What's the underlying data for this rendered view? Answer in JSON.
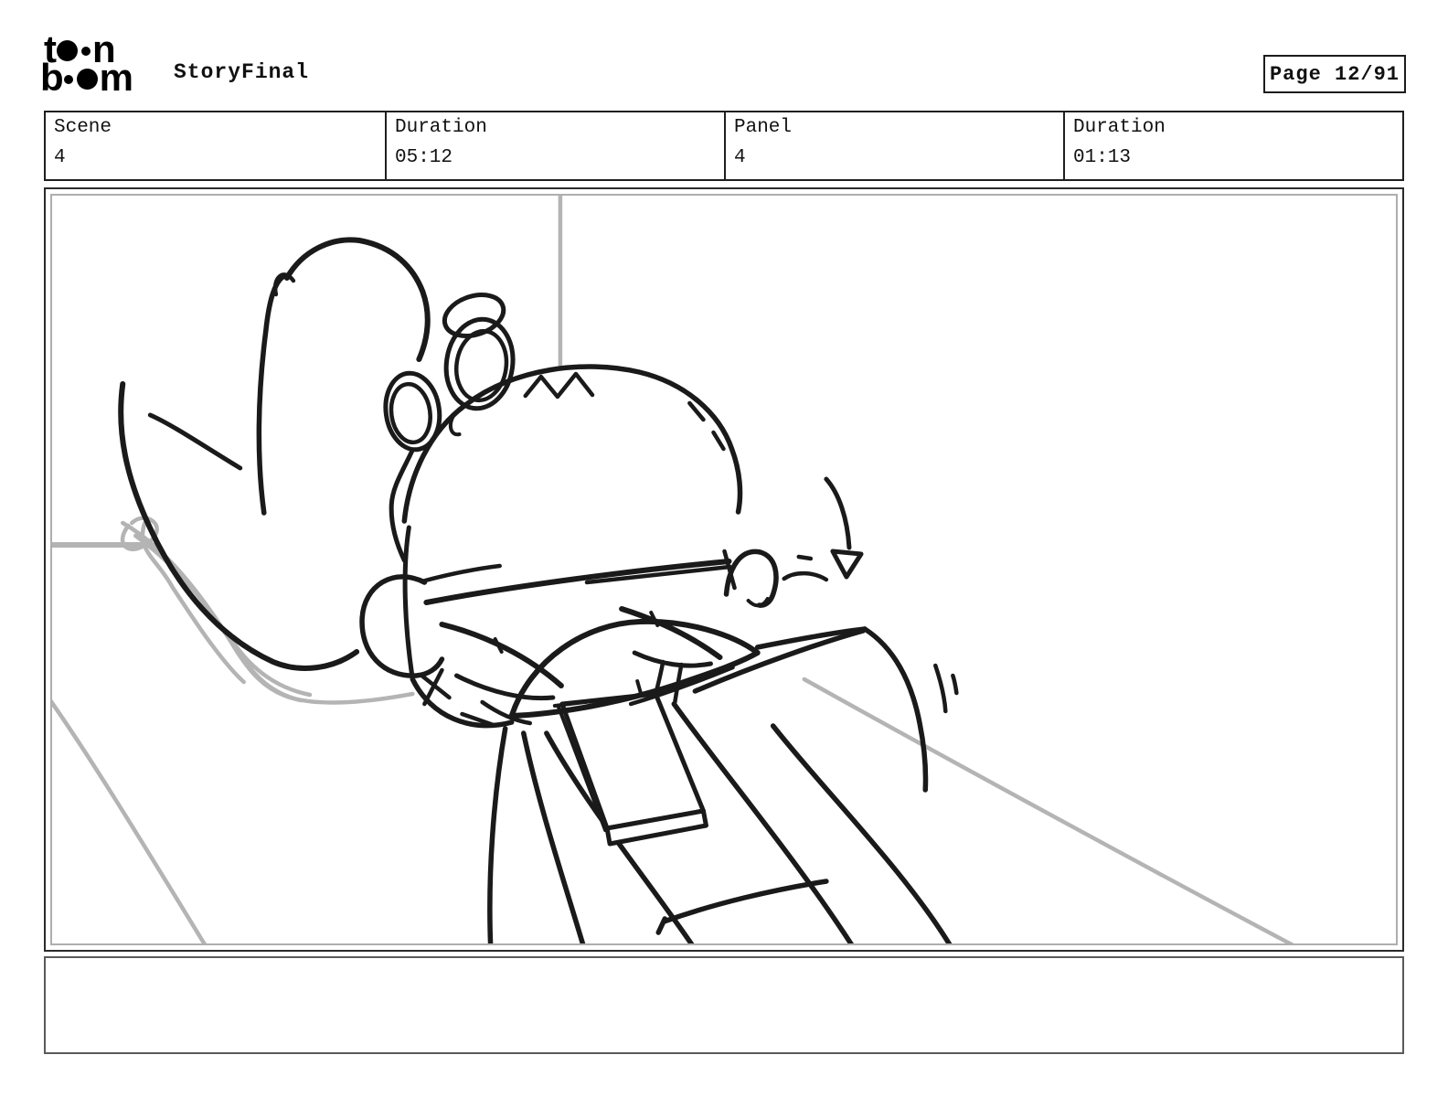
{
  "header": {
    "logo": {
      "alt": "toon boom",
      "rows": [
        [
          {
            "t": "c",
            "v": "t"
          },
          {
            "t": "c",
            "v": "o"
          },
          {
            "t": "ds"
          },
          {
            "t": "c",
            "v": "n"
          }
        ],
        [
          {
            "t": "c",
            "v": "b"
          },
          {
            "t": "ds"
          },
          {
            "t": "db"
          },
          {
            "t": "c",
            "v": "m"
          }
        ]
      ]
    },
    "title": "StoryFinal",
    "page_label": "Page 12/91"
  },
  "info_row": {
    "cells": [
      {
        "label": "Scene",
        "value": "4"
      },
      {
        "label": "Duration",
        "value": "05:12"
      },
      {
        "label": "Panel",
        "value": "4"
      },
      {
        "label": "Duration",
        "value": "01:13"
      }
    ]
  },
  "panel": {
    "description": "Rough pencil storyboard sketch: a big-haired character reclines on a lounge chair seen from their left side, eyes half closed, with a closed book resting on their chest and a small arrow indicating downward motion; light gray guide lines mark the wall corner, chair back and floor.",
    "colors": {
      "ink": "#1a1a1a",
      "guide": "#b4b4b4"
    }
  },
  "caption": {
    "text": ""
  }
}
